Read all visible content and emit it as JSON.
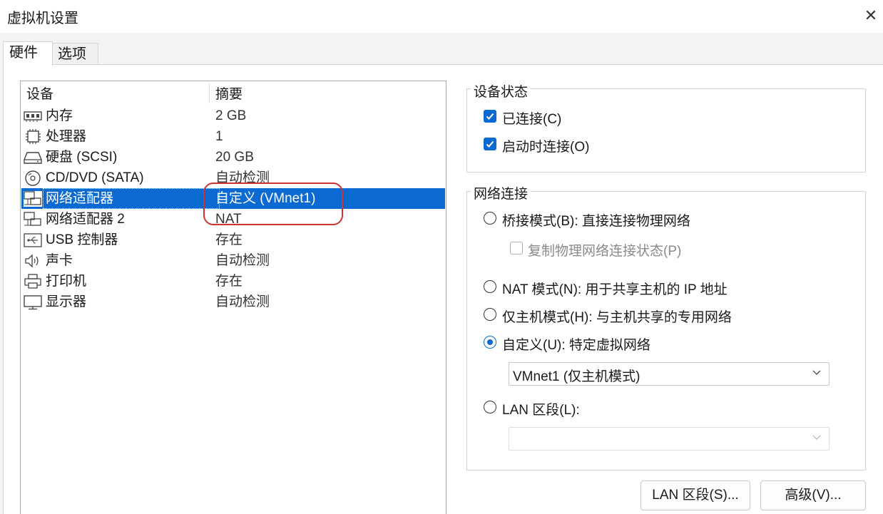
{
  "window": {
    "title": "虚拟机设置",
    "close_glyph": "✕"
  },
  "tabs": [
    {
      "label": "硬件",
      "active": true
    },
    {
      "label": "选项",
      "active": false
    }
  ],
  "device_list": {
    "columns": [
      "设备",
      "摘要"
    ],
    "rows": [
      {
        "icon": "memory-icon",
        "name": "内存",
        "summary": "2 GB"
      },
      {
        "icon": "cpu-icon",
        "name": "处理器",
        "summary": "1"
      },
      {
        "icon": "harddisk-icon",
        "name": "硬盘 (SCSI)",
        "summary": "20 GB"
      },
      {
        "icon": "cd-dvd-icon",
        "name": "CD/DVD (SATA)",
        "summary": "自动检测"
      },
      {
        "icon": "network-adapter-icon",
        "name": "网络适配器",
        "summary": "自定义 (VMnet1)",
        "selected": true
      },
      {
        "icon": "network-adapter-icon",
        "name": "网络适配器 2",
        "summary": "NAT"
      },
      {
        "icon": "usb-icon",
        "name": "USB 控制器",
        "summary": "存在"
      },
      {
        "icon": "speaker-icon",
        "name": "声卡",
        "summary": "自动检测"
      },
      {
        "icon": "printer-icon",
        "name": "打印机",
        "summary": "存在"
      },
      {
        "icon": "monitor-icon",
        "name": "显示器",
        "summary": "自动检测"
      }
    ]
  },
  "device_status": {
    "title": "设备状态",
    "connected": {
      "label": "已连接(C)",
      "checked": true
    },
    "connect_at_power_on": {
      "label": "启动时连接(O)",
      "checked": true
    }
  },
  "network_connection": {
    "title": "网络连接",
    "bridged": {
      "label": "桥接模式(B): 直接连接物理网络",
      "selected": false
    },
    "replicate": {
      "label": "复制物理网络连接状态(P)",
      "checked": false,
      "enabled": false
    },
    "nat": {
      "label": "NAT 模式(N): 用于共享主机的 IP 地址",
      "selected": false
    },
    "host_only": {
      "label": "仅主机模式(H): 与主机共享的专用网络",
      "selected": false
    },
    "custom": {
      "label": "自定义(U): 特定虚拟网络",
      "selected": true
    },
    "custom_select_value": "VMnet1 (仅主机模式)",
    "lan_segment": {
      "label": "LAN 区段(L):",
      "selected": false
    },
    "lan_segment_select_value": ""
  },
  "buttons": {
    "lan_segments": "LAN 区段(S)...",
    "advanced": "高级(V)..."
  },
  "colors": {
    "accent": "#0a6ad2",
    "annotation": "#d23232"
  }
}
